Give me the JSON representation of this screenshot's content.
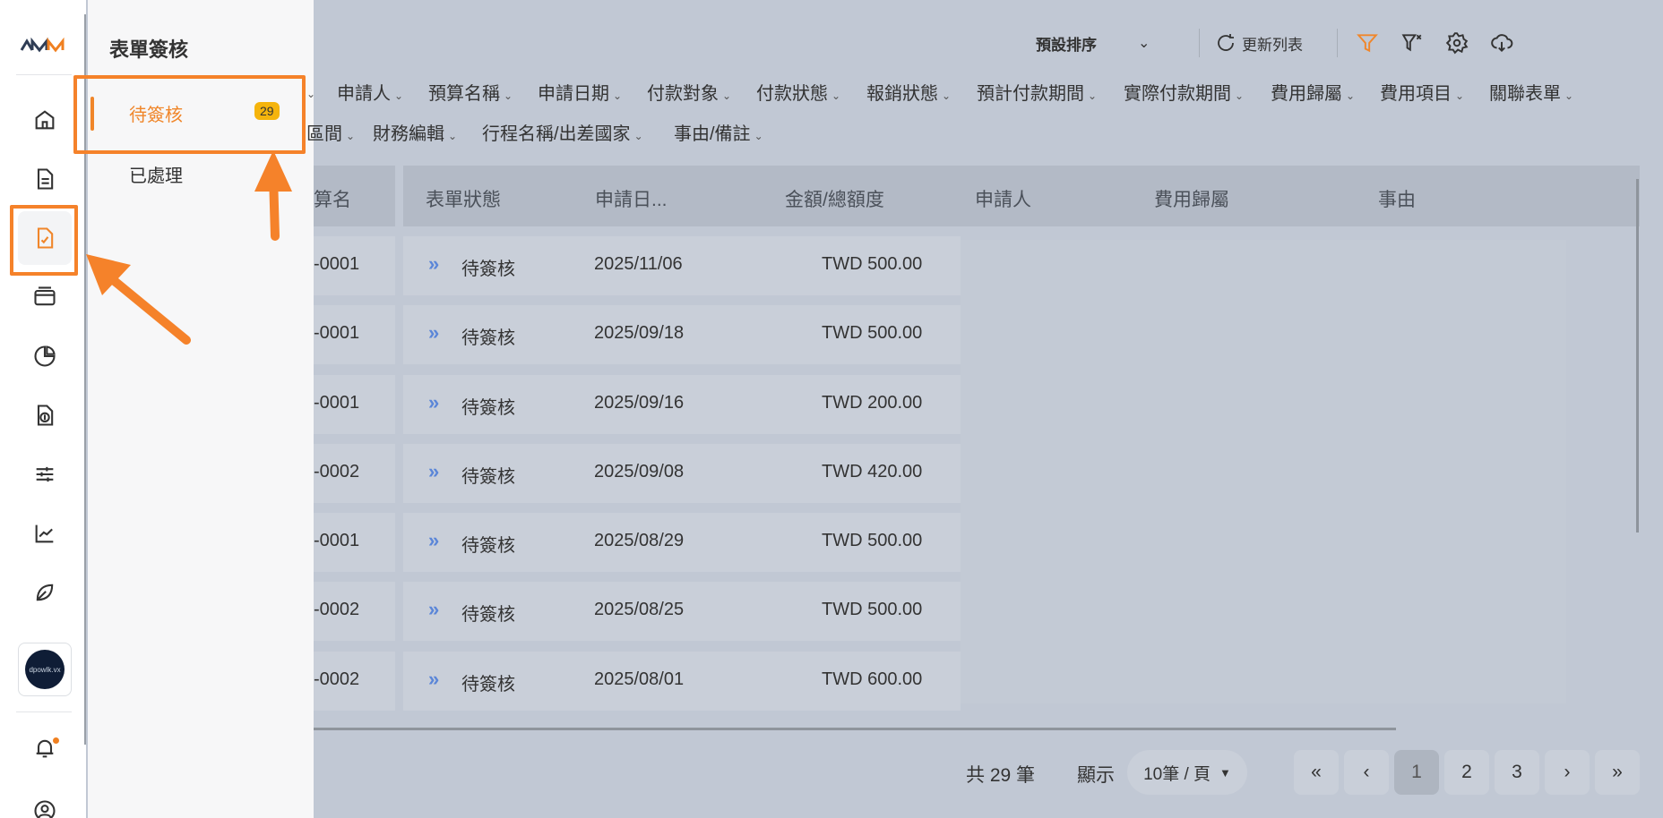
{
  "submenu": {
    "title": "表單簽核",
    "items": [
      {
        "label": "待簽核",
        "badge": "29"
      },
      {
        "label": "已處理"
      }
    ]
  },
  "toolbar": {
    "sort_label": "預設排序",
    "refresh_label": "更新列表"
  },
  "filters": {
    "row1": [
      "申請人",
      "預算名稱",
      "申請日期",
      "付款對象",
      "付款狀態",
      "報銷狀態",
      "預計付款期間",
      "實際付款期間",
      "費用歸屬",
      "費用項目",
      "關聯表單"
    ],
    "row2": [
      "區間",
      "財務編輯",
      "行程名稱/出差國家",
      "事由/備註"
    ]
  },
  "table": {
    "headers": [
      "算名",
      "表單狀態",
      "申請日...",
      "金額/總額度",
      "申請人",
      "費用歸屬",
      "事由"
    ],
    "rows": [
      {
        "id": "-0001",
        "status": "待簽核",
        "date": "2025/11/06",
        "amount": "TWD 500.00"
      },
      {
        "id": "-0001",
        "status": "待簽核",
        "date": "2025/09/18",
        "amount": "TWD 500.00"
      },
      {
        "id": "-0001",
        "status": "待簽核",
        "date": "2025/09/16",
        "amount": "TWD 200.00"
      },
      {
        "id": "-0002",
        "status": "待簽核",
        "date": "2025/09/08",
        "amount": "TWD 420.00"
      },
      {
        "id": "-0001",
        "status": "待簽核",
        "date": "2025/08/29",
        "amount": "TWD 500.00"
      },
      {
        "id": "-0002",
        "status": "待簽核",
        "date": "2025/08/25",
        "amount": "TWD 500.00"
      },
      {
        "id": "-0002",
        "status": "待簽核",
        "date": "2025/08/01",
        "amount": "TWD 600.00"
      }
    ]
  },
  "footer": {
    "total": "共 29 筆",
    "show_label": "顯示",
    "page_size": "10筆 / 頁",
    "pages": [
      "1",
      "2",
      "3"
    ],
    "first": "«",
    "prev": "‹",
    "next": "›",
    "last": "»"
  },
  "avatar_text": "dpowlk.vx",
  "colors": {
    "accent": "#f0862a",
    "badge": "#f5b40c",
    "overlay": "#c1c8d4",
    "link": "#5b86d8"
  }
}
